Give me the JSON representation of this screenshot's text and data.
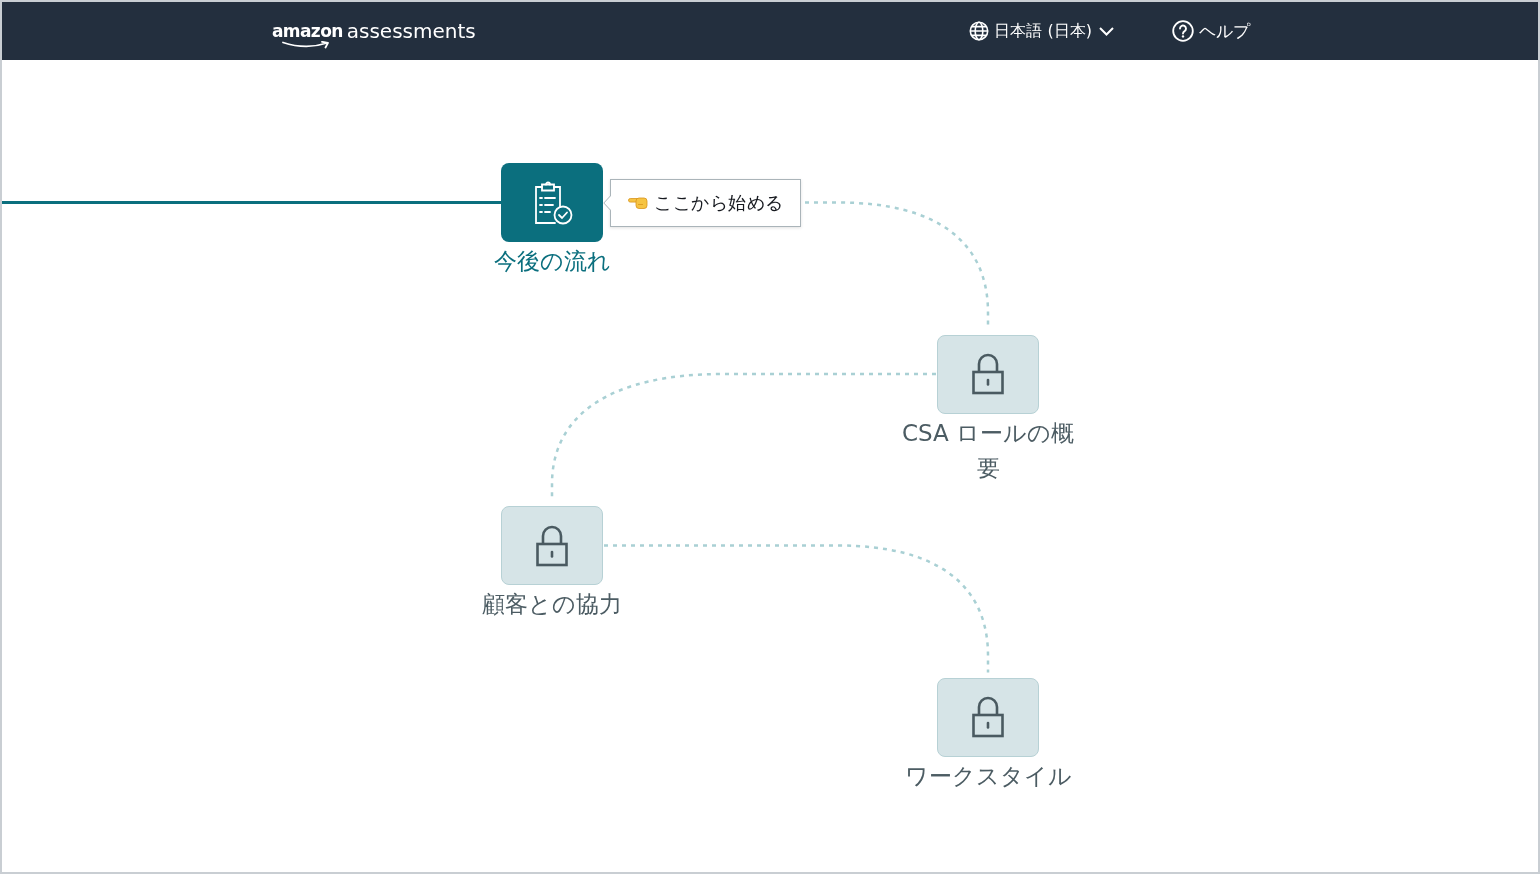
{
  "header": {
    "logo": {
      "brand": "amazon",
      "product": "assessments"
    },
    "language": {
      "label": "日本語 (日本)"
    },
    "help": {
      "label": "ヘルプ"
    }
  },
  "path": {
    "nodes": [
      {
        "label": "今後の流れ",
        "locked": false,
        "tooltip": {
          "text": "ここから始める"
        }
      },
      {
        "label": "CSA ロールの概要",
        "locked": true
      },
      {
        "label": "顧客との協力",
        "locked": true
      },
      {
        "label": "ワークスタイル",
        "locked": true
      }
    ]
  }
}
